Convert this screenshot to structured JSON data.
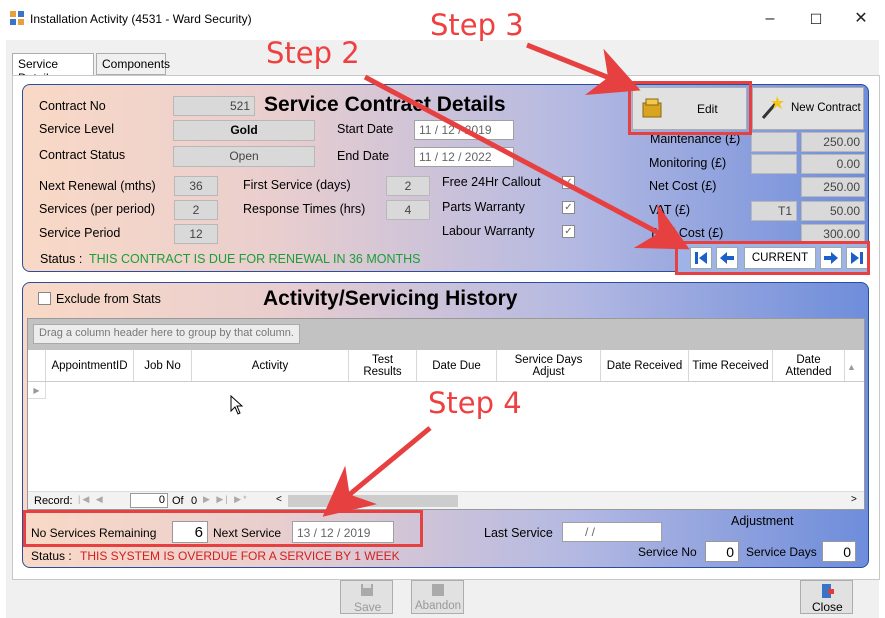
{
  "window": {
    "title": "Installation Activity (4531 - Ward Security)",
    "minimize": "–",
    "maximize": "☐",
    "close": "✕"
  },
  "tabs": [
    "Service Details",
    "Components"
  ],
  "contract": {
    "heading": "Service Contract Details",
    "contract_no_label": "Contract No",
    "contract_no": "521",
    "service_level_label": "Service Level",
    "service_level": "Gold",
    "contract_status_label": "Contract Status",
    "contract_status": "Open",
    "start_date_label": "Start Date",
    "start_date": "11 /  12 / 2019",
    "end_date_label": "End Date",
    "end_date": "11 /  12 / 2022",
    "next_renewal_label": "Next Renewal (mths)",
    "next_renewal": "36",
    "services_per_period_label": "Services (per period)",
    "services_per_period": "2",
    "service_period_label": "Service Period",
    "service_period": "12",
    "first_service_label": "First Service (days)",
    "first_service": "2",
    "response_times_label": "Response Times (hrs)",
    "response_times": "4",
    "free_callout_label": "Free 24Hr Callout",
    "parts_warranty_label": "Parts Warranty",
    "labour_warranty_label": "Labour Warranty",
    "status_label": "Status :",
    "status": "THIS CONTRACT IS DUE FOR RENEWAL IN 36 MONTHS"
  },
  "costs": {
    "maintenance_label": "Maintenance (£)",
    "maintenance": "250.00",
    "monitoring_label": "Monitoring (£)",
    "monitoring": "0.00",
    "net_cost_label": "Net Cost (£)",
    "net_cost": "250.00",
    "vat_label": "VAT (£)",
    "vat_code": "T1",
    "vat": "50.00",
    "total_cost_label": "Total Cost (£)",
    "total_cost": "300.00"
  },
  "buttons": {
    "edit": "Edit",
    "new_contract": "New Contract",
    "current": "CURRENT",
    "save": "Save",
    "abandon": "Abandon",
    "close": "Close"
  },
  "history": {
    "exclude_label": "Exclude from Stats",
    "heading": "Activity/Servicing History",
    "group_hint": "Drag a column header here to group by that column.",
    "columns": [
      "AppointmentID",
      "Job No",
      "Activity",
      "Test\nResults",
      "Date Due",
      "Service Days\nAdjust",
      "Date Received",
      "Time Received",
      "Date\nAttended"
    ],
    "record_label": "Record:",
    "record_value": "0",
    "of_label": "Of",
    "of_value": "0"
  },
  "service": {
    "remaining_label": "No Services Remaining",
    "remaining": "6",
    "next_label": "Next Service",
    "next": "13 /  12 /  2019",
    "last_label": "Last Service",
    "last": "/       /",
    "adjustment_label": "Adjustment",
    "service_no_label": "Service No",
    "service_no": "0",
    "service_days_label": "Service Days",
    "service_days": "0",
    "status_label": "Status :",
    "status": "THIS SYSTEM IS OVERDUE FOR A SERVICE BY 1 WEEK"
  },
  "annotations": {
    "step2": "Step 2",
    "step3": "Step 3",
    "step4": "Step 4"
  },
  "colors": {
    "callout": "#e74040",
    "accent": "#2c4d9c"
  }
}
